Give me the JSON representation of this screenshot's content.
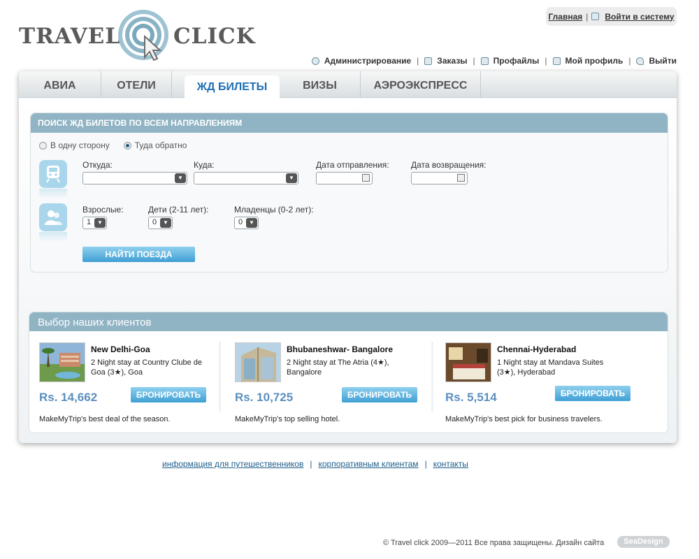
{
  "logo": {
    "word1": "TRAVEL",
    "word2": "CLICK"
  },
  "toplinks": {
    "home": "Главная",
    "sep": "|",
    "login": "Войти в систему"
  },
  "adminnav": [
    {
      "label": "Администрирование",
      "icon": "gear-icon"
    },
    {
      "label": "Заказы",
      "icon": "orders-icon"
    },
    {
      "label": "Профайлы",
      "icon": "profiles-icon"
    },
    {
      "label": "Мой профиль",
      "icon": "my-profile-icon"
    },
    {
      "label": "Выйти",
      "icon": "key-icon"
    }
  ],
  "tabs": [
    {
      "label": "АВИА",
      "active": false
    },
    {
      "label": "ОТЕЛИ",
      "active": false
    },
    {
      "label": "ЖД БИЛЕТЫ",
      "active": true
    },
    {
      "label": "ВИЗЫ",
      "active": false
    },
    {
      "label": "АЭРОЭКСПРЕСС",
      "active": false
    }
  ],
  "search": {
    "title": "ПОИСК ЖД БИЛЕТОВ ПО ВСЕМ НАПРАВЛЕНИЯМ",
    "one_way": "В одну сторону",
    "round_trip": "Туда обратно",
    "selected_trip": "round_trip",
    "from_label": "Откуда:",
    "to_label": "Куда:",
    "depart_label": "Дата отправления:",
    "return_label": "Дата возвращения:",
    "adults_label": "Взрослые:",
    "adults_value": "1",
    "children_label": "Дети (2-11 лет):",
    "children_value": "0",
    "infants_label": "Младенцы (0-2 лет):",
    "infants_value": "0",
    "find_button": "НАЙТИ ПОЕЗДА"
  },
  "choice": {
    "title": "Выбор наших клиентов",
    "deals": [
      {
        "title": "New Delhi-Goa",
        "desc": "2 Night stay at Country Clube de Goa (3★), Goa",
        "price": "Rs. 14,662",
        "book": "БРОНИРОВАТЬ",
        "note": "MakeMyTrip's best deal of the season."
      },
      {
        "title": "Bhubaneshwar- Bangalore",
        "desc": "2 Night stay at The Atria (4★), Bangalore",
        "price": "Rs. 10,725",
        "book": "БРОНИРОВАТЬ",
        "note": "MakeMyTrip's top selling hotel."
      },
      {
        "title": "Chennai-Hyderabad",
        "desc": "1 Night stay at Mandava Suites (3★), Hyderabad",
        "price": "Rs. 5,514",
        "book": "БРОНИРОВАТЬ",
        "note": "MakeMyTrip's best pick for business travelers."
      }
    ]
  },
  "footer": {
    "links": [
      "информация для путешественников",
      "корпоративным клиентам",
      "контакты"
    ],
    "sep": "|",
    "copyright": "© Travel click  2009—2011  Все права защищены.    Дизайн сайта",
    "design_badge": "SeaDesign"
  },
  "colors": {
    "accent": "#1f6fb5",
    "header_bar": "#90b4c4",
    "button": "#3f9fd4",
    "price": "#5b8fc0"
  }
}
